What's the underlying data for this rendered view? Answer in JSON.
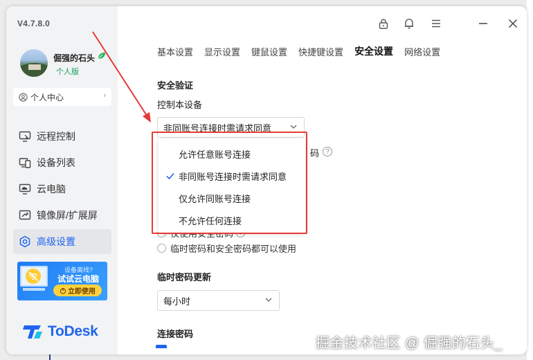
{
  "app": {
    "version": "V4.7.8.0",
    "username": "倔强的石头",
    "plan": "个人版",
    "personal_center": "个人中心",
    "brand": "ToDesk"
  },
  "sidebar": {
    "items": [
      {
        "label": "远程控制",
        "icon": "remote-control-icon"
      },
      {
        "label": "设备列表",
        "icon": "device-list-icon"
      },
      {
        "label": "云电脑",
        "icon": "cloud-pc-icon"
      },
      {
        "label": "镜像屏/扩展屏",
        "icon": "mirror-screen-icon"
      },
      {
        "label": "高级设置",
        "icon": "advanced-settings-icon",
        "active": true
      }
    ],
    "promo": {
      "line1": "设备离线?",
      "line2": "试试云电脑",
      "button": "立即使用"
    }
  },
  "toolbar": {
    "icons": [
      "lock-icon",
      "bell-icon",
      "menu-icon",
      "minimize-icon",
      "close-icon"
    ]
  },
  "tabs": [
    {
      "label": "基本设置"
    },
    {
      "label": "显示设置"
    },
    {
      "label": "键鼠设置"
    },
    {
      "label": "快捷键设置"
    },
    {
      "label": "安全设置",
      "active": true
    },
    {
      "label": "网络设置"
    }
  ],
  "security": {
    "section_title": "安全验证",
    "control_label": "控制本设备",
    "control_selected": "非同账号连接时需请求同意",
    "hidden_tail": "码",
    "radio_partial": "仅使用安全密码",
    "radio_both": "临时密码和安全密码都可以使用"
  },
  "dropdown": {
    "options": [
      {
        "label": "允许任意账号连接",
        "checked": false
      },
      {
        "label": "非同账号连接时需请求同意",
        "checked": true
      },
      {
        "label": "仅允许同账号连接",
        "checked": false
      },
      {
        "label": "不允许任何连接",
        "checked": false
      }
    ]
  },
  "temp_password": {
    "title": "临时密码更新",
    "value": "每小时"
  },
  "connect_password": {
    "title": "连接密码"
  },
  "watermark": "掘金技术社区 @ 倔强的石头_",
  "colors": {
    "accent": "#1f64f0",
    "highlight_red": "#e53935",
    "plan_green": "#18a058"
  }
}
